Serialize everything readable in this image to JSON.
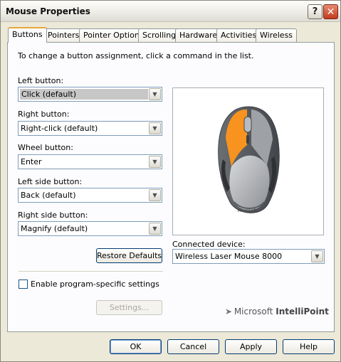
{
  "window": {
    "title": "Mouse Properties"
  },
  "titlebar_buttons": {
    "help": "?",
    "close": "✕"
  },
  "tabs": [
    "Buttons",
    "Pointers",
    "Pointer Options",
    "Scrolling",
    "Hardware",
    "Activities",
    "Wireless"
  ],
  "active_tab": "Buttons",
  "instruction": "To change a button assignment, click a command in the list.",
  "assignments": [
    {
      "label": "Left button:",
      "value": "Click (default)"
    },
    {
      "label": "Right button:",
      "value": "Right-click (default)"
    },
    {
      "label": "Wheel button:",
      "value": "Enter"
    },
    {
      "label": "Left side button:",
      "value": "Back (default)"
    },
    {
      "label": "Right side button:",
      "value": "Magnify (default)"
    }
  ],
  "restore_defaults_label": "Restore Defaults",
  "connected_device": {
    "label": "Connected device:",
    "value": "Wireless Laser Mouse 8000"
  },
  "program_specific": {
    "label": "Enable program-specific settings",
    "checked": false
  },
  "settings_button_label": "Settings...",
  "brand": {
    "name": "Microsoft",
    "product": "IntelliPoint"
  },
  "mouse_image": {
    "brand_text": "Microsoft",
    "highlight_color": "#f7931e"
  },
  "footer_buttons": {
    "ok": "OK",
    "cancel": "Cancel",
    "apply": "Apply",
    "help": "Help"
  }
}
